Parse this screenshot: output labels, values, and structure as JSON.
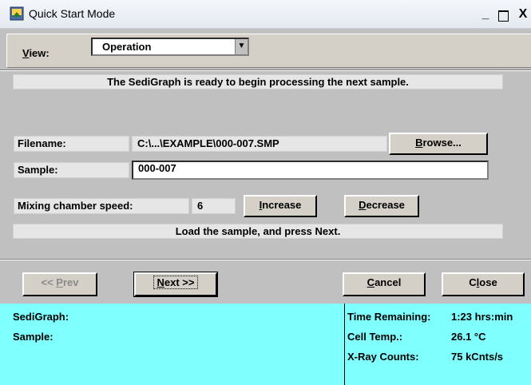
{
  "window": {
    "title": "Quick Start Mode",
    "controls": {
      "minimize": "_",
      "maximize": "□",
      "close": "X"
    }
  },
  "view": {
    "label_underlined": "V",
    "label_rest": "iew:",
    "selected": "Operation"
  },
  "messages": {
    "ready": "The SediGraph is ready to begin processing the next sample.",
    "instruction": "Load the sample, and press Next."
  },
  "file": {
    "label": "Filename:",
    "value": "C:\\...\\EXAMPLE\\000-007.SMP",
    "browse_underlined": "B",
    "browse_rest": "rowse..."
  },
  "sample": {
    "label": "Sample:",
    "value": "000-007"
  },
  "mixing": {
    "label": "Mixing chamber speed:",
    "value": "6",
    "increase_underlined": "I",
    "increase_rest": "ncrease",
    "decrease_underlined": "D",
    "decrease_rest": "ecrease"
  },
  "nav": {
    "prev_pre": "<< ",
    "prev_underlined": "P",
    "prev_rest": "rev",
    "next_underlined": "N",
    "next_rest": "ext >>",
    "cancel_underlined": "C",
    "cancel_rest": "ancel",
    "close_pre": "C",
    "close_underlined": "l",
    "close_rest": "ose"
  },
  "status": {
    "sedigraph_label": "SediGraph:",
    "sample_label": "Sample:",
    "time_label": "Time Remaining:",
    "time_value": "1:23 hrs:min",
    "cell_temp_label": "Cell Temp.:",
    "cell_temp_value": "26.1 °C",
    "xray_label": "X-Ray Counts:",
    "xray_value": "75 kCnts/s"
  },
  "colors": {
    "panel": "#c0c0c0",
    "status_panel": "#80ffff",
    "strip": "#e6e6e6"
  },
  "icons": {
    "app": "scanner-app-icon",
    "combo_arrow": "chevron-down-icon"
  }
}
